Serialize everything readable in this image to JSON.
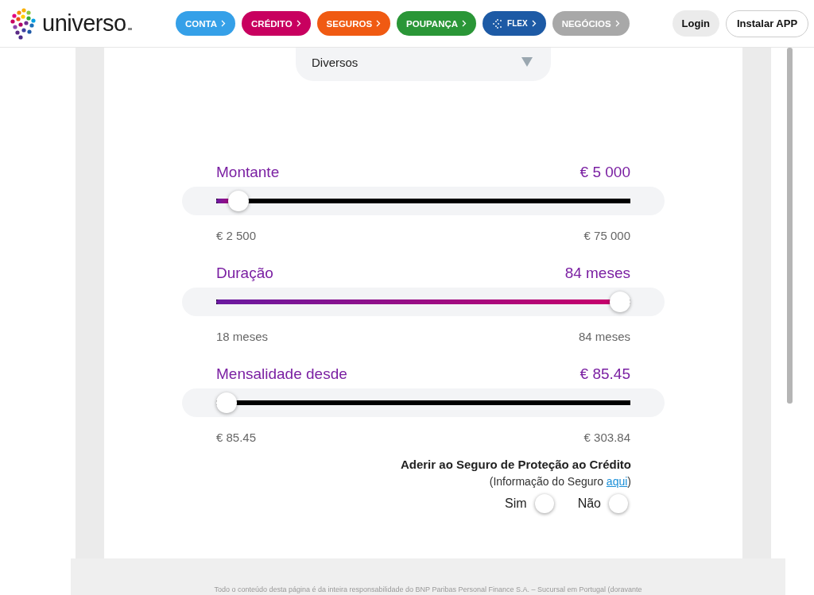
{
  "header": {
    "logo": "universo",
    "nav": [
      {
        "label": "CONTA",
        "color": "#35a0e8"
      },
      {
        "label": "CRÉDITO",
        "color": "#c8005f"
      },
      {
        "label": "SEGUROS",
        "color": "#f05a12"
      },
      {
        "label": "POUPANÇA",
        "color": "#2a9637"
      },
      {
        "label": "FLEX",
        "color": "#1d5aa5"
      },
      {
        "label": "NEGÓCIOS",
        "color": "#a8a8a8"
      }
    ],
    "login": "Login",
    "install": "Instalar APP"
  },
  "dropdown": {
    "value": "Diversos"
  },
  "sliders": [
    {
      "label": "Montante",
      "value": "€ 5 000",
      "level": 0.03,
      "min": "€ 2 500",
      "max": "€ 75 000"
    },
    {
      "label": "Duração",
      "value": "84 meses",
      "level": 1,
      "min": "18 meses",
      "max": "84 meses"
    },
    {
      "label": "Mensalidade desde",
      "value": "€ 85.45",
      "level": 0,
      "min": "€ 85.45",
      "max": "€ 303.84"
    }
  ],
  "insurance": {
    "title": "Aderir ao Seguro de Proteção ao Crédito",
    "info_before": "(Informação do Seguro ",
    "link": "aqui",
    "info_after": ")",
    "options": [
      {
        "label": "Sim",
        "selected": false
      },
      {
        "label": "Não",
        "selected": false
      }
    ]
  },
  "footer": {
    "text": "Todo o conteúdo desta página é da inteira responsabilidade do BNP Paribas Personal Finance S.A. – Sucursal em Portugal (doravante"
  }
}
